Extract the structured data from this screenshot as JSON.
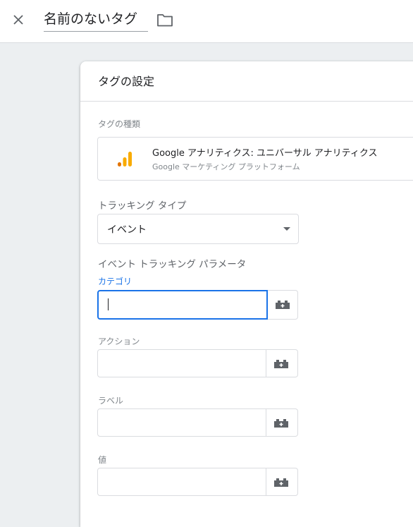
{
  "header": {
    "tag_name": "名前のないタグ"
  },
  "card": {
    "title": "タグの設定",
    "tag_type_label": "タグの種類",
    "tag_type": {
      "name": "Google アナリティクス: ユニバーサル アナリティクス",
      "platform": "Google マーケティング プラットフォーム",
      "icon": "analytics-bars-icon"
    },
    "tracking_type_label": "トラッキング タイプ",
    "tracking_type_value": "イベント",
    "params_label": "イベント トラッキング パラメータ",
    "fields": [
      {
        "label": "カテゴリ",
        "value": ""
      },
      {
        "label": "アクション",
        "value": ""
      },
      {
        "label": "ラベル",
        "value": ""
      },
      {
        "label": "値",
        "value": ""
      }
    ]
  },
  "colors": {
    "accent": "#1a73e8",
    "analytics_orange": "#f9ab00",
    "analytics_dark_orange": "#e37400"
  }
}
